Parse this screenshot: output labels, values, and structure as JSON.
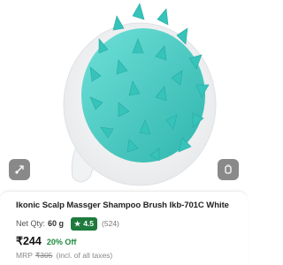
{
  "product": {
    "title": "Ikonic Scalp Massger Shampoo Brush Ikb-701C White",
    "image_icon": "scalp-brush-image",
    "net_qty_label": "Net Qty:",
    "net_qty_value": "60 g",
    "rating": "4.5",
    "rating_count": "(524)",
    "price": "₹244",
    "discount": "20% Off",
    "mrp_label": "MRP",
    "mrp_value": "₹305",
    "tax_note": "(incl. of all taxes)"
  },
  "actions": {
    "share_icon": "share-icon",
    "wishlist_icon": "wishlist-icon"
  },
  "colors": {
    "brush_bristles": "#3ec8c0",
    "rating_badge": "#1f7a3e",
    "discount_text": "#1f8a3e",
    "action_button": "#7d7d7d"
  }
}
